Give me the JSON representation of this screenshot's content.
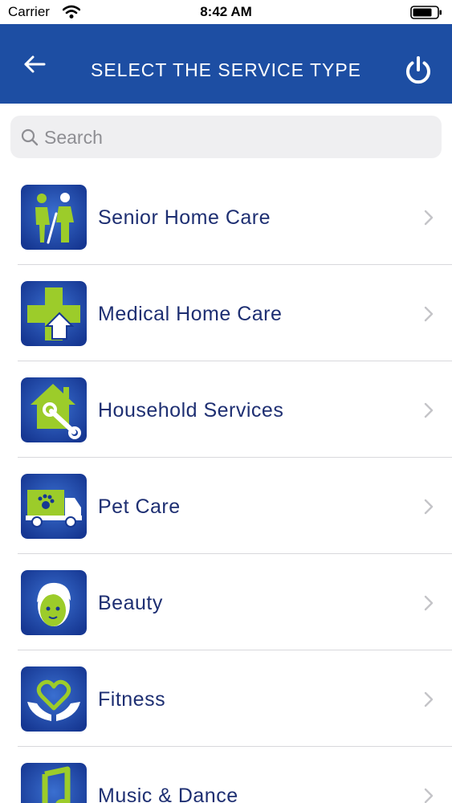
{
  "status_bar": {
    "carrier": "Carrier",
    "time": "8:42 AM"
  },
  "nav": {
    "title": "SELECT THE SERVICE TYPE",
    "back_icon": "back-arrow-icon",
    "power_icon": "power-icon"
  },
  "search": {
    "placeholder": "Search",
    "value": ""
  },
  "services": [
    {
      "label": "Senior Home Care",
      "icon": "senior-care-icon"
    },
    {
      "label": "Medical Home Care",
      "icon": "medical-care-icon"
    },
    {
      "label": "Household Services",
      "icon": "household-services-icon"
    },
    {
      "label": "Pet Care",
      "icon": "pet-care-icon"
    },
    {
      "label": "Beauty",
      "icon": "beauty-icon"
    },
    {
      "label": "Fitness",
      "icon": "fitness-icon"
    },
    {
      "label": "Music & Dance",
      "icon": "music-dance-icon"
    }
  ],
  "colors": {
    "nav_bg": "#1d4ea3",
    "label": "#1e2f72",
    "icon_bg": "#1a3f9e",
    "icon_accent": "#9ccc2a"
  }
}
